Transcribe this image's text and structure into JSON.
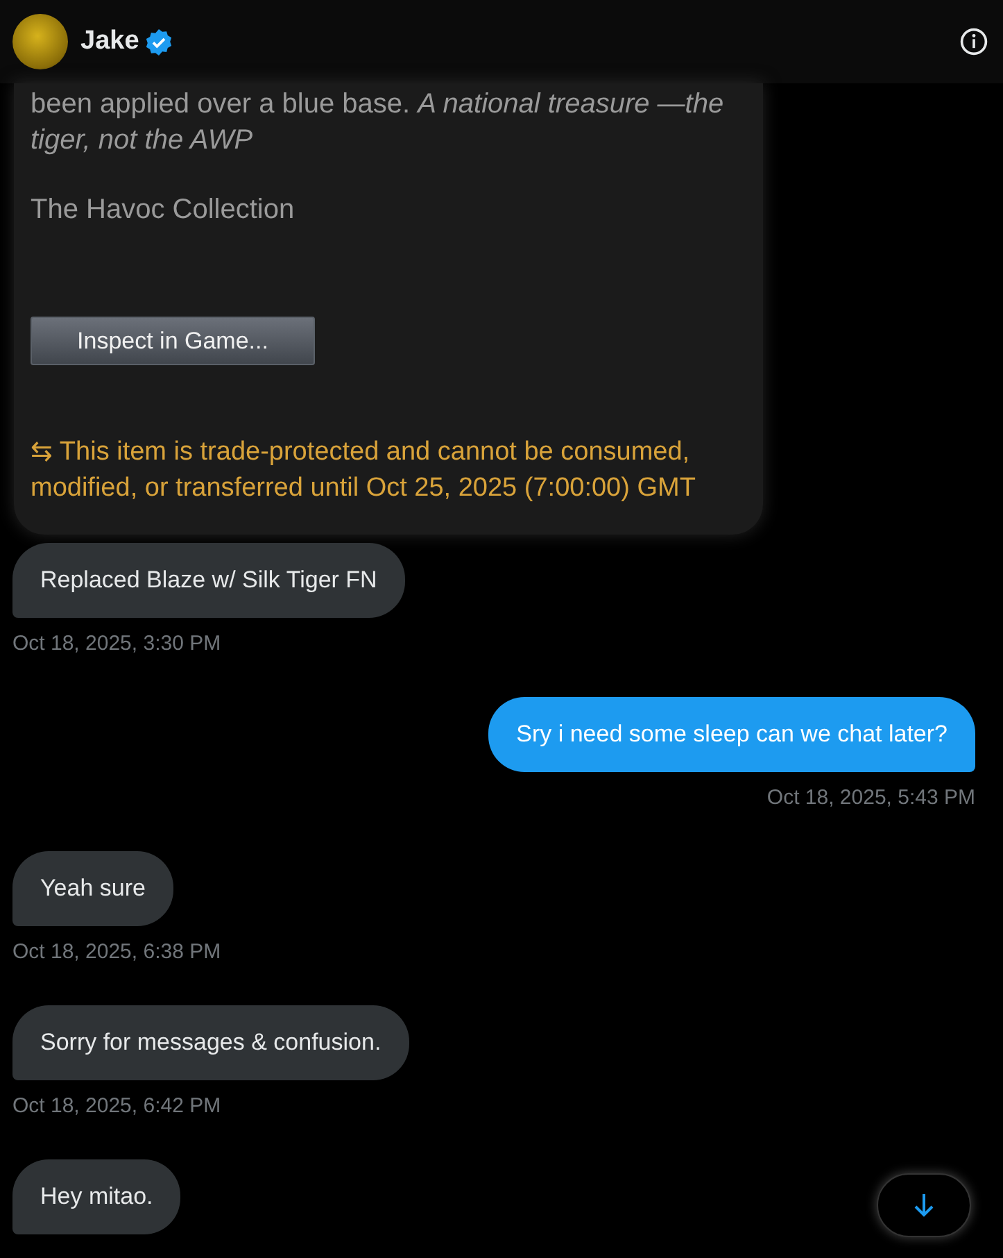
{
  "header": {
    "name": "Jake",
    "verified": true
  },
  "card": {
    "description": "been applied over a blue base. *A national treasure —the tiger, not the AWP*",
    "collection": "The Havoc Collection",
    "button": "Inspect in Game...",
    "warning_icon": "⇆",
    "warning": "This item is trade-protected and cannot be consumed, modified, or transferred until Oct 25, 2025 (7:00:00) GMT"
  },
  "messages": [
    {
      "kind": "received",
      "text": "Replaced Blaze w/ Silk Tiger FN",
      "time": "Oct 18, 2025, 3:30 PM"
    },
    {
      "kind": "sent",
      "text": "Sry i need some sleep can we chat later?",
      "time": "Oct 18, 2025, 5:43 PM"
    },
    {
      "kind": "received",
      "text": "Yeah sure",
      "time": "Oct 18, 2025, 6:38 PM"
    },
    {
      "kind": "received",
      "text": "Sorry for messages & confusion.",
      "time": "Oct 18, 2025, 6:42 PM"
    },
    {
      "kind": "received",
      "text": "Hey mitao."
    }
  ]
}
